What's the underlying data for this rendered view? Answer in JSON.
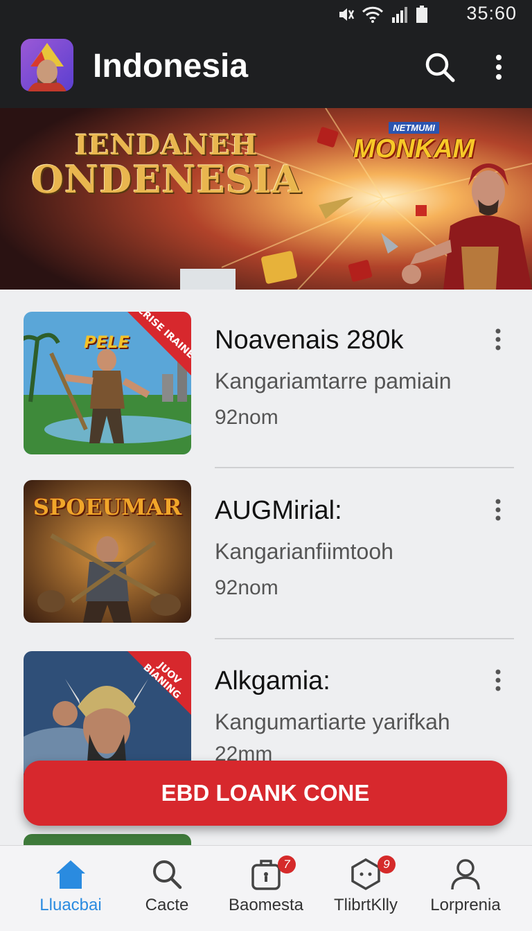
{
  "status_bar": {
    "time": "35:60"
  },
  "app_bar": {
    "title": "Indonesia"
  },
  "banner": {
    "line1": "IENDANEH",
    "line2": "ONDENESIA",
    "badge_top": "NETMUMI",
    "badge_main": "MONKAM"
  },
  "items": [
    {
      "title": "Noavenais 280k",
      "subtitle": "Kangariamtarre pamiain",
      "meta": "92nom",
      "thumb_text": "PELE",
      "ribbon": "CRISE IRAINE"
    },
    {
      "title": "AUGMirial:",
      "subtitle": "Kangarianfiimtooh",
      "meta": "92nom",
      "thumb_text": "SPOEUMAR",
      "ribbon": ""
    },
    {
      "title": "Alkgamia:",
      "subtitle": "Kangumartiarte yarifkah",
      "meta": "22mm",
      "thumb_text": "",
      "ribbon": "JUOV BIANING"
    }
  ],
  "cta": {
    "label": "EBD LOANK CONE"
  },
  "nav": [
    {
      "label": "Lluacbai",
      "icon": "home-icon",
      "badge": ""
    },
    {
      "label": "Cacte",
      "icon": "search-icon",
      "badge": ""
    },
    {
      "label": "Baomesta",
      "icon": "bag-icon",
      "badge": "7"
    },
    {
      "label": "TlibrtKlly",
      "icon": "hexagon-icon",
      "badge": "9"
    },
    {
      "label": "Lorprenia",
      "icon": "profile-icon",
      "badge": ""
    }
  ],
  "colors": {
    "accent_red": "#d7282d",
    "nav_active": "#2a8be0",
    "bar_dark": "#1e1f21"
  }
}
